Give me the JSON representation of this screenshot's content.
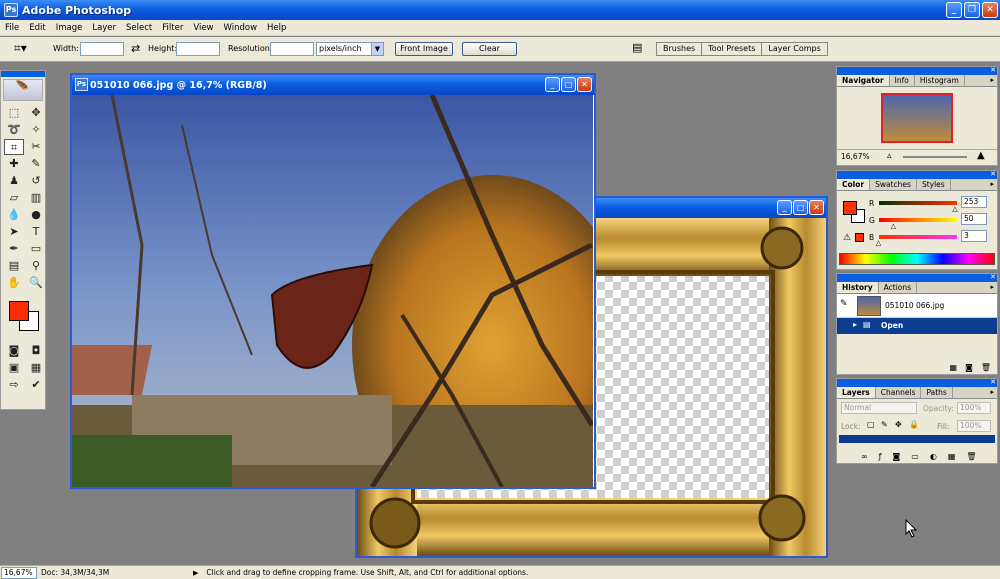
{
  "app": {
    "title": "Adobe Photoshop"
  },
  "menu": [
    "File",
    "Edit",
    "Image",
    "Layer",
    "Select",
    "Filter",
    "View",
    "Window",
    "Help"
  ],
  "options": {
    "width_label": "Width:",
    "height_label": "Height:",
    "resolution_label": "Resolution:",
    "units": "pixels/inch",
    "front_image": "Front Image",
    "clear": "Clear"
  },
  "well_tabs": [
    "Brushes",
    "Tool Presets",
    "Layer Comps"
  ],
  "documents": {
    "photo": {
      "title": "051010 066.jpg @ 16,7% (RGB/8)"
    }
  },
  "navigator": {
    "tabs": [
      "Navigator",
      "Info",
      "Histogram"
    ],
    "zoom": "16,67%"
  },
  "color": {
    "tabs": [
      "Color",
      "Swatches",
      "Styles"
    ],
    "r_label": "R",
    "r_value": "253",
    "r_fraction": 0.99,
    "g_label": "G",
    "g_value": "50",
    "g_fraction": 0.2,
    "b_label": "B",
    "b_value": "3",
    "b_fraction": 0.01,
    "foreground": "#fd3203"
  },
  "history": {
    "tabs": [
      "History",
      "Actions"
    ],
    "snapshot": "051010 066.jpg",
    "state": "Open"
  },
  "layers": {
    "tabs": [
      "Layers",
      "Channels",
      "Paths"
    ],
    "blend_mode": "Normal",
    "opacity_label": "Opacity:",
    "opacity_value": "100%",
    "lock_label": "Lock:",
    "fill_label": "Fill:",
    "fill_value": "100%"
  },
  "status": {
    "zoom": "16,67%",
    "doc": "Doc: 34,3M/34,3M",
    "hint": "Click and drag to define cropping frame. Use Shift, Alt, and Ctrl for additional options."
  },
  "colors": {
    "accent": "#0a5fe0",
    "chrome": "#ece9d8",
    "workspace": "#808080"
  }
}
